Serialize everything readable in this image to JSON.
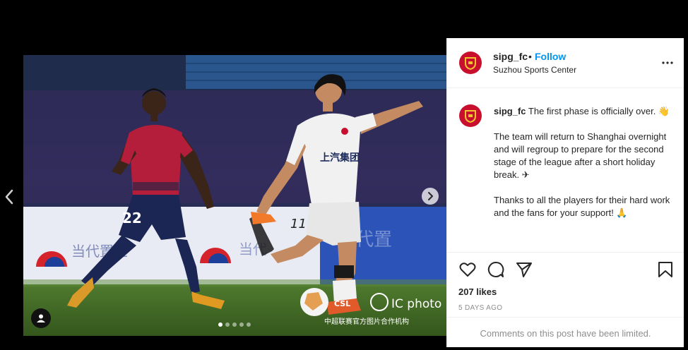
{
  "post": {
    "username": "sipg_fc",
    "separator": "•",
    "follow_label": "Follow",
    "location": "Suzhou Sports Center",
    "caption_paragraphs": [
      "The first phase is officially over. 👋",
      "The team will return to Shanghai overnight and will regroup to prepare for the second stage of the league after a short holiday break. ✈",
      "Thanks to all the players for their hard work and the fans for your support! 🙏"
    ],
    "likes": "207 likes",
    "time_ago": "5 DAYS AGO",
    "comments_notice": "Comments on this post have been limited."
  },
  "media": {
    "watermark_brand": "CSL",
    "watermark_credit": "IC photo",
    "watermark_caption": "中超联赛官方图片合作机构",
    "player_left_number": "22",
    "player_right_number": "11",
    "sponsor_text": "上汽集团",
    "board_text": "当代置业",
    "carousel_total": 5,
    "carousel_active": 0
  },
  "icons": {
    "prev": "chevron-left-icon",
    "next": "chevron-right-icon",
    "tag": "user-tag-icon",
    "more": "more-options-icon",
    "like": "heart-icon",
    "comment": "comment-icon",
    "share": "send-icon",
    "save": "bookmark-icon"
  },
  "colors": {
    "follow": "#0095f6",
    "club_red": "#c8102e",
    "text": "#262626",
    "muted": "#8e8e8e"
  }
}
